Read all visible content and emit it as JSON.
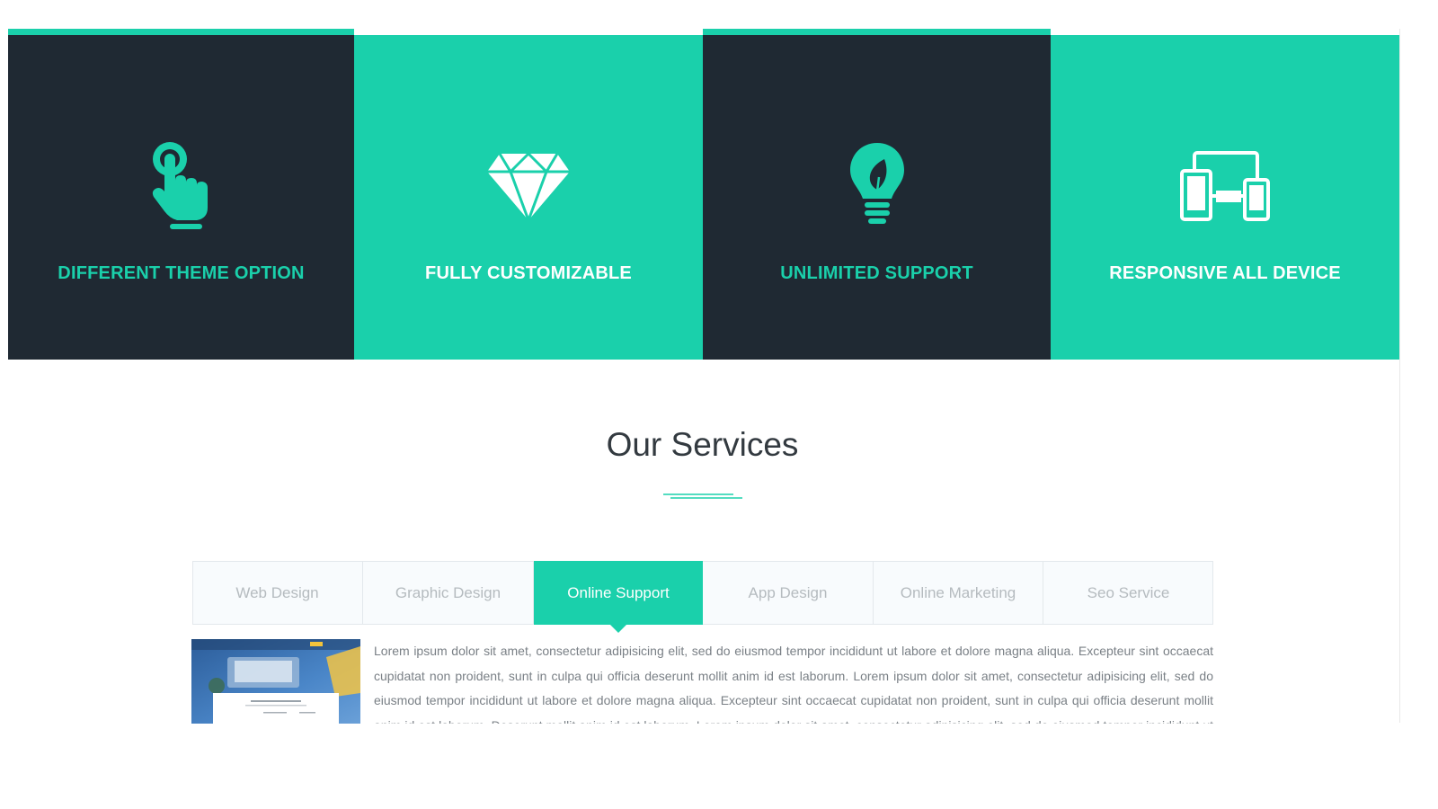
{
  "colors": {
    "accent": "#1ad0ab",
    "dark": "#1f2933",
    "title_text": "#333a40",
    "tab_text": "#b5bbbf",
    "body_text": "#7a8086"
  },
  "features": [
    {
      "title": "DIFFERENT THEME OPTION",
      "icon": "pointing-hand-icon",
      "style": "dark"
    },
    {
      "title": "FULLY CUSTOMIZABLE",
      "icon": "diamond-icon",
      "style": "green"
    },
    {
      "title": "UNLIMITED SUPPORT",
      "icon": "lightbulb-leaf-icon",
      "style": "dark"
    },
    {
      "title": "RESPONSIVE ALL DEVICE",
      "icon": "responsive-devices-icon",
      "style": "green"
    }
  ],
  "services": {
    "title": "Our Services",
    "tabs": [
      {
        "label": "Web Design",
        "active": false
      },
      {
        "label": "Graphic Design",
        "active": false
      },
      {
        "label": "Online Support",
        "active": true
      },
      {
        "label": "App Design",
        "active": false
      },
      {
        "label": "Online Marketing",
        "active": false
      },
      {
        "label": "Seo Service",
        "active": false
      }
    ],
    "thumbnail_icon": "website-preview-image",
    "body": "Lorem ipsum dolor sit amet, consectetur adipisicing elit, sed do eiusmod tempor incididunt ut labore et dolore magna aliqua. Excepteur sint occaecat cupidatat non proident, sunt in culpa qui officia deserunt mollit anim id est laborum. Lorem ipsum dolor sit amet, consectetur adipisicing elit, sed do eiusmod tempor incididunt ut labore et dolore magna aliqua. Excepteur sint occaecat cupidatat non proident, sunt in culpa qui officia deserunt mollit anim id est laborum. Deserunt mollit anim id est laborum. Lorem ipsum dolor sit amet, consectetur adipisicing elit, sed do eiusmod tempor incididunt ut labore"
  }
}
